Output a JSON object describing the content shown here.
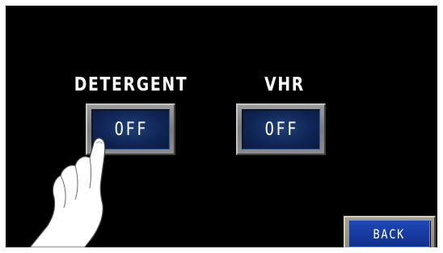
{
  "panel": {
    "background": "#000000"
  },
  "detergent": {
    "label": "DETERGENT",
    "state": "OFF"
  },
  "vhr": {
    "label": "VHR",
    "state": "OFF"
  },
  "back": {
    "label": "BACK"
  },
  "colors": {
    "button_face": "#102656",
    "back_face": "#1a40a8",
    "button_bezel": "#8a8a8a",
    "back_bezel": "#9c9878"
  },
  "overlay": {
    "icon": "pointing-hand-icon"
  }
}
